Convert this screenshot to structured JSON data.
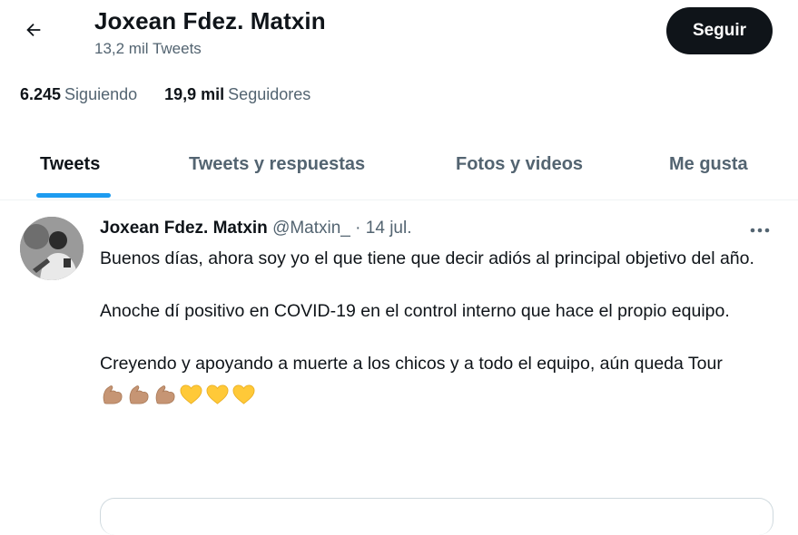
{
  "header": {
    "back_icon": "arrow-left-icon",
    "name": "Joxean Fdez. Matxin",
    "tweet_count": "13,2 mil Tweets",
    "follow_label": "Seguir"
  },
  "stats": {
    "following_count": "6.245",
    "following_label": "Siguiendo",
    "followers_count": "19,9 mil",
    "followers_label": "Seguidores"
  },
  "tabs": [
    {
      "label": "Tweets",
      "active": true
    },
    {
      "label": "Tweets y respuestas",
      "active": false
    },
    {
      "label": "Fotos y videos",
      "active": false
    },
    {
      "label": "Me gusta",
      "active": false
    }
  ],
  "tweet": {
    "author_name": "Joxean Fdez. Matxin",
    "handle": "@Matxin_",
    "separator": "·",
    "date": "14 jul.",
    "more_icon": "more-horizontal-icon",
    "paragraphs": [
      "Buenos días, ahora soy yo el que tiene que decir adiós al principal objetivo del año.",
      "Anoche dí positivo en COVID-19 en el control interno que hace el propio equipo.",
      "Creyendo y apoyando a muerte a los chicos y a todo el equipo, aún queda Tour"
    ],
    "emojis": [
      "flexed-biceps-icon",
      "flexed-biceps-icon",
      "flexed-biceps-icon",
      "yellow-heart-icon",
      "yellow-heart-icon",
      "yellow-heart-icon"
    ]
  },
  "colors": {
    "accent": "#1d9bf0",
    "text_primary": "#0f1419",
    "text_secondary": "#536471",
    "button_bg": "#0f1419",
    "heart": "#ffc938",
    "biceps": "#c69574"
  }
}
